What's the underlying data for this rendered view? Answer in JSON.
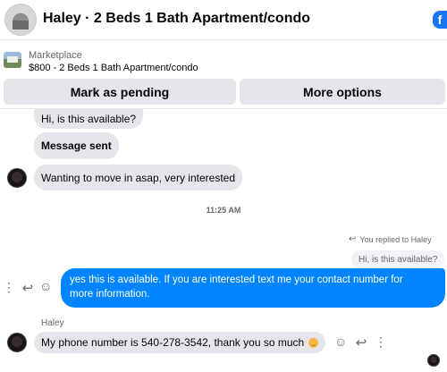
{
  "header": {
    "title": "Haley · 2 Beds 1 Bath Apartment/condo",
    "logo": "f"
  },
  "marketplace": {
    "label": "Marketplace",
    "listing": "$800 - 2 Beds 1 Bath Apartment/condo"
  },
  "actions": {
    "mark_pending": "Mark as pending",
    "more_options": "More options"
  },
  "messages": {
    "m1": "Hi, is this available?",
    "m2": "Message sent",
    "m3": "Wanting to move in asap, very interested",
    "timestamp": "11:25 AM",
    "replied_label": "You replied to Haley",
    "quoted": "Hi, is this available?",
    "reply_line1": "yes this is available. If you are interested text me your contact number for",
    "reply_line2": "more information.",
    "sender": "Haley",
    "m4": "My phone number is 540-278-3542, thank you so much"
  },
  "icons": {
    "more": "⋮",
    "reply": "↩",
    "react": "☺",
    "replied": "↩"
  },
  "colors": {
    "accent": "#0084ff",
    "bubble_gray": "#e4e6eb",
    "button_gray": "#e4e6eb",
    "secondary_text": "#65676b"
  }
}
